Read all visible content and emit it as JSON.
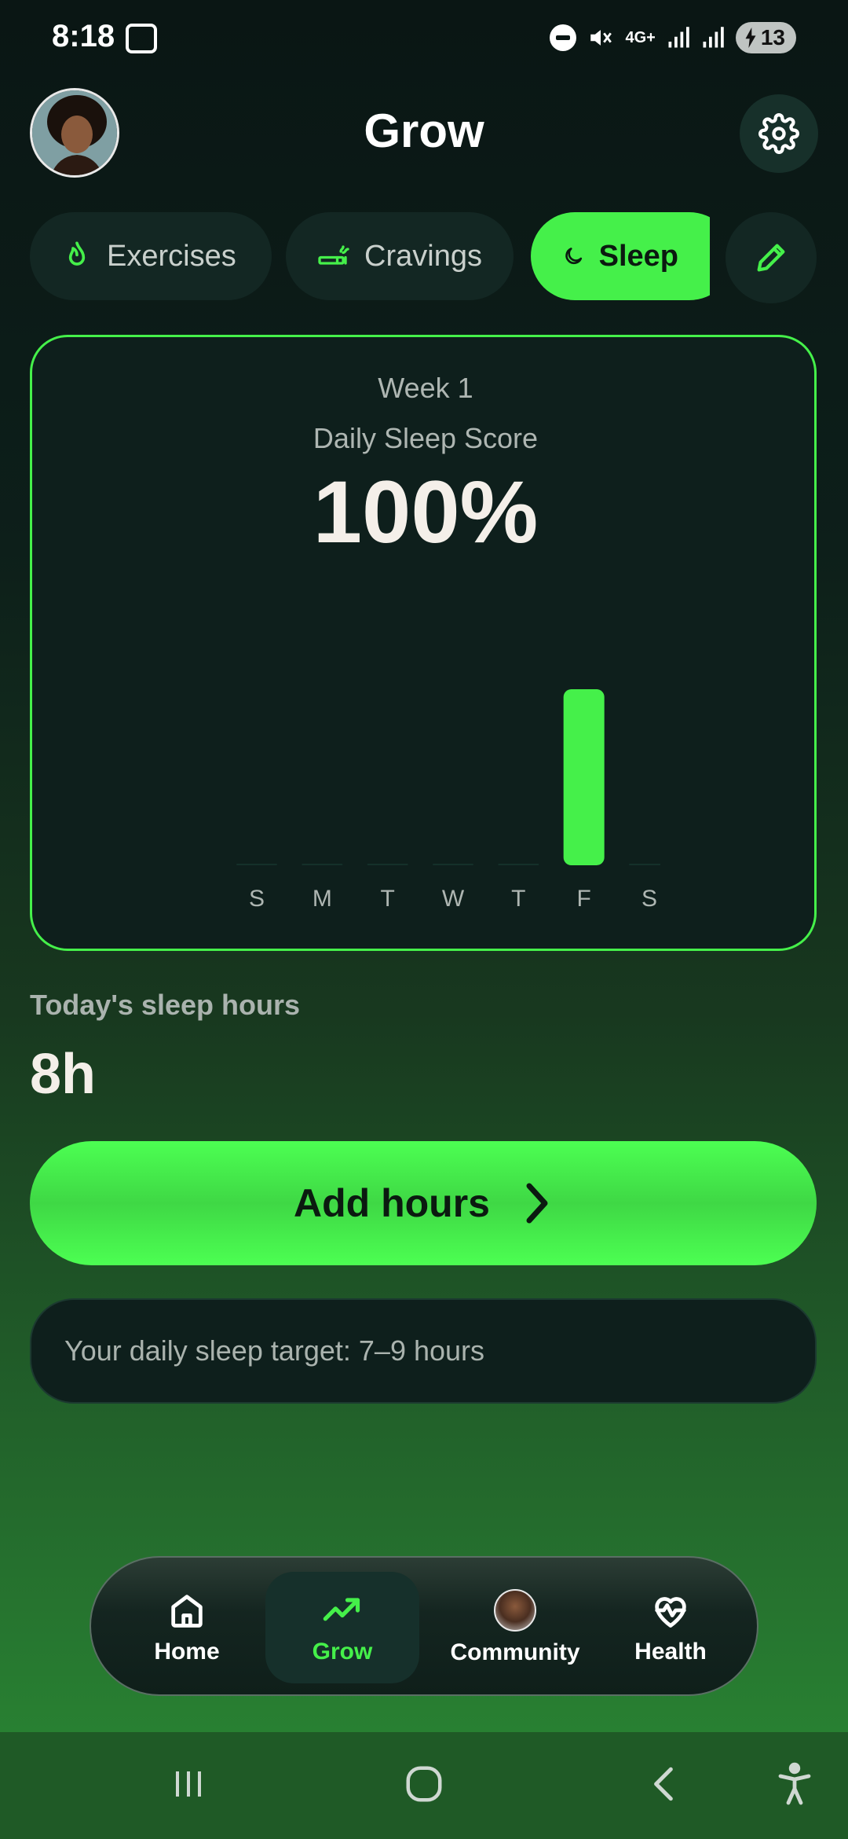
{
  "status_bar": {
    "time": "8:18",
    "network": "4G+",
    "battery": "13",
    "icons": [
      "screenshot-icon",
      "dnd-icon",
      "mute-icon",
      "signal-icon",
      "signal-icon",
      "battery-charging-icon"
    ]
  },
  "header": {
    "title": "Grow",
    "avatar_icon": "avatar",
    "settings_icon": "gear-icon"
  },
  "tabs": [
    {
      "label": "Exercises",
      "icon": "flame-icon",
      "selected": false
    },
    {
      "label": "Cravings",
      "icon": "cigarette-icon",
      "selected": false
    },
    {
      "label": "Sleep",
      "icon": "moon-icon",
      "selected": true
    }
  ],
  "edit_icon": "pencil-icon",
  "score_card": {
    "week": "Week 1",
    "label": "Daily Sleep Score",
    "value": "100%"
  },
  "chart_data": {
    "type": "bar",
    "categories": [
      "S",
      "M",
      "T",
      "W",
      "T",
      "F",
      "S"
    ],
    "values": [
      0,
      0,
      0,
      0,
      0,
      100,
      0
    ],
    "ylim": [
      0,
      100
    ],
    "bar_color": "#45f04a",
    "title": "",
    "xlabel": "",
    "ylabel": ""
  },
  "today": {
    "label": "Today's sleep hours",
    "value": "8h"
  },
  "add_button": {
    "label": "Add hours",
    "icon": "chevron-right-icon"
  },
  "target": {
    "text": "Your daily sleep target: 7–9 hours"
  },
  "bottom_nav": [
    {
      "label": "Home",
      "icon": "home-icon",
      "active": false
    },
    {
      "label": "Grow",
      "icon": "trending-up-icon",
      "active": true
    },
    {
      "label": "Community",
      "icon": "avatar",
      "active": false
    },
    {
      "label": "Health",
      "icon": "heart-pulse-icon",
      "active": false
    }
  ],
  "colors": {
    "accent": "#45f04a",
    "background_top": "#0a1614",
    "background_bottom": "#2a8a34",
    "card": "#0e1f1c"
  }
}
